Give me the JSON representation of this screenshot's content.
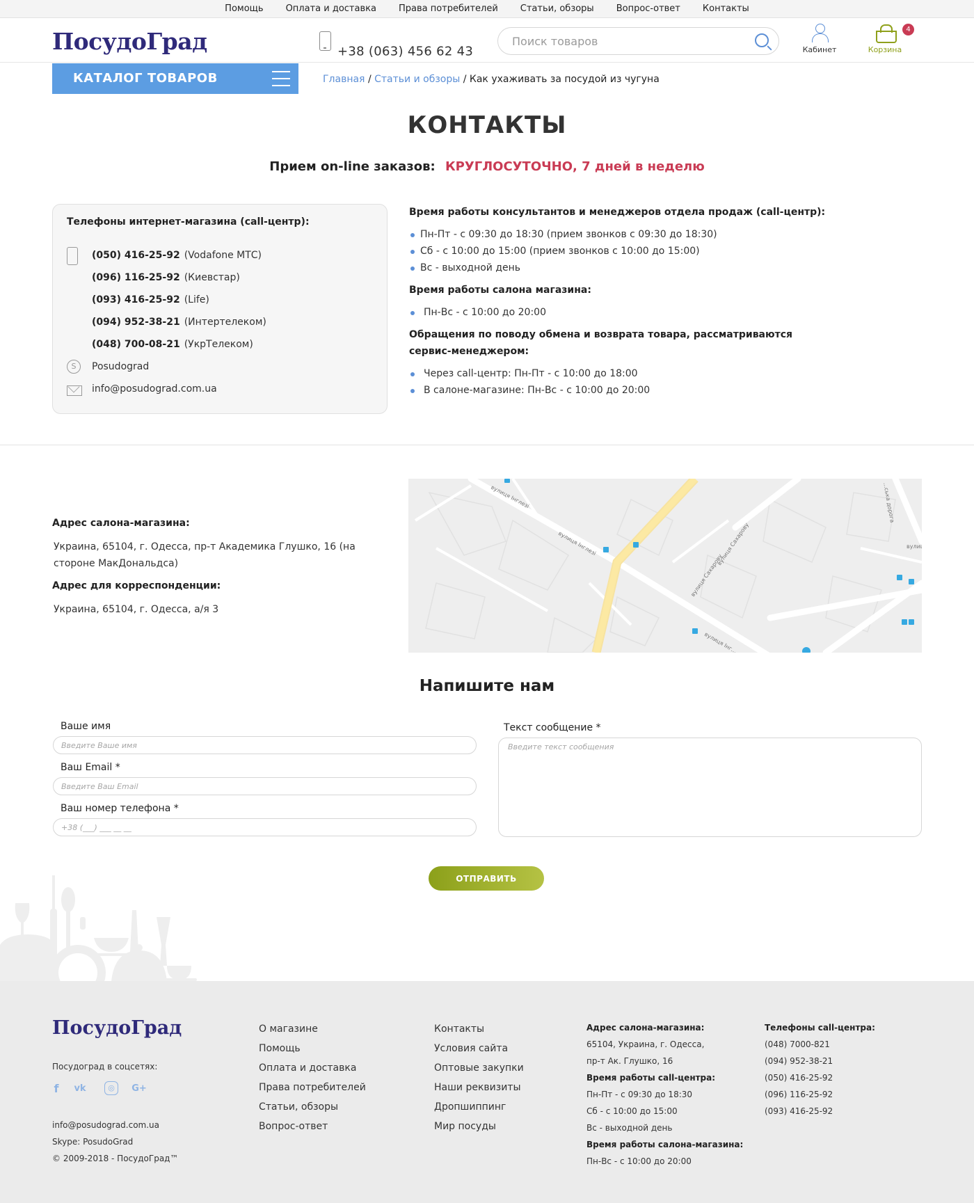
{
  "topnav": [
    "Помощь",
    "Оплата и доставка",
    "Права потребителей",
    "Статьи, обзоры",
    "Вопрос-ответ",
    "Контакты"
  ],
  "header": {
    "logo": "ПосудоГрад",
    "phone": "+38 (063) 456 62 43",
    "search_placeholder": "Поиск товаров",
    "cabinet_label": "Кабинет",
    "cart_label": "Корзина",
    "cart_count": "4"
  },
  "catalog_label": "КАТАЛОГ ТОВАРОВ",
  "breadcrumb": {
    "home": "Главная",
    "sep": "/",
    "articles": "Статьи и обзоры",
    "current": "Как ухаживать за посудой из чугуна"
  },
  "page_title": "КОНТАКТЫ",
  "online": {
    "label": "Прием on-line заказов:",
    "value": "КРУГЛОСУТОЧНО, 7 дней в неделю"
  },
  "phones": {
    "title": "Телефоны интернет-магазина (call-центр):",
    "items": [
      {
        "number": "(050) 416-25-92",
        "operator": "(Vodafone МТС)"
      },
      {
        "number": "(096) 116-25-92",
        "operator": "(Киевстар)"
      },
      {
        "number": "(093) 416-25-92",
        "operator": "(Life)"
      },
      {
        "number": "(094) 952-38-21",
        "operator": "(Интертелеком)"
      },
      {
        "number": "(048) 700-08-21",
        "operator": "(УкрТелеком)"
      }
    ],
    "skype": "Posudograd",
    "email": "info@posudograd.com.ua"
  },
  "hours": {
    "callcenter_title": "Время работы консультантов и менеджеров отдела продаж (call-центр):",
    "callcenter": [
      "Пн-Пт - с 09:30 до 18:30 (прием звонков с 09:30 до 18:30)",
      "Сб - с 10:00 до 15:00 (прием звонков с 10:00 до 15:00)",
      "Вс - выходной день"
    ],
    "salon_title": "Время работы салона магазина:",
    "salon": [
      "Пн-Вс - с 10:00 до 20:00"
    ],
    "returns_title": "Обращения по поводу обмена и возврата товара, рассматриваются сервис-менеджером:",
    "returns": [
      "Через call-центр: Пн-Пт - с 10:00 до 18:00",
      "В салоне-магазине: Пн-Вс - с 10:00 до 20:00"
    ]
  },
  "address": {
    "salon_title": "Адрес салона-магазина:",
    "salon": "Украина, 65104, г. Одесса, пр-т Академика Глушко, 16 (на стороне МакДональдса)",
    "mail_title": "Адрес для корреспонденции:",
    "mail": "Украина, 65104, г. Одесса, а/я 3"
  },
  "map": {
    "street_1": "вулиця Інглезі",
    "street_2": "вулиця Інглезі",
    "street_3": "вулиця Сахарову",
    "street_4": "вулиця Сахарову",
    "street_5": "вулиця Інг...",
    "street_6": "...ська дорога",
    "street_7": "вулиц..."
  },
  "form": {
    "title": "Напишите нам",
    "name_label": "Ваше имя",
    "name_placeholder": "Введите Ваше имя",
    "email_label": "Ваш Email *",
    "email_placeholder": "Введите Ваш Email",
    "phone_label": "Ваш номер телефона *",
    "phone_placeholder": "+38 (___) ___ __ __",
    "message_label": "Текст сообщение *",
    "message_placeholder": "Введите текст сообщения",
    "submit": "ОТПРАВИТЬ"
  },
  "footer": {
    "logo": "ПосудоГрад",
    "social_label": "Посудоград в соцсетях:",
    "social_icons": [
      "facebook-icon",
      "vk-icon",
      "instagram-icon",
      "google-plus-icon"
    ],
    "email": "info@posudograd.com.ua",
    "skype": "Skype: PosudoGrad",
    "copyright": "© 2009-2018 - ПосудоГрад™",
    "col1": [
      "О магазине",
      "Помощь",
      "Оплата и доставка",
      "Права потребителей",
      "Статьи, обзоры",
      "Вопрос-ответ"
    ],
    "col2": [
      "Контакты",
      "Условия сайта",
      "Оптовые закупки",
      "Наши реквизиты",
      "Дропшиппинг",
      "Мир посуды"
    ],
    "info": {
      "salon_title": "Адрес салона-магазина:",
      "salon_line1": "65104, Украина, г. Одесса,",
      "salon_line2": "пр-т Ак. Глушко, 16",
      "cc_title": "Время работы call-центра:",
      "cc_line1": "Пн-Пт - с 09:30 до 18:30",
      "cc_line2": "Сб - с 10:00 до 15:00",
      "cc_line3": "Вс - выходной день",
      "shop_title": "Время работы салона-магазина:",
      "shop_line1": "Пн-Вс - с 10:00 до 20:00"
    },
    "phones_title": "Телефоны call-центра:",
    "phones": [
      "(048) 7000-821",
      "(094) 952-38-21",
      "(050) 416-25-92",
      "(096) 116-25-92",
      "(093) 416-25-92"
    ]
  },
  "colors": {
    "brand": "#2f2a7a",
    "accent_blue": "#5c9de2",
    "accent_red": "#c93b54",
    "accent_green": "#8fa01b"
  }
}
